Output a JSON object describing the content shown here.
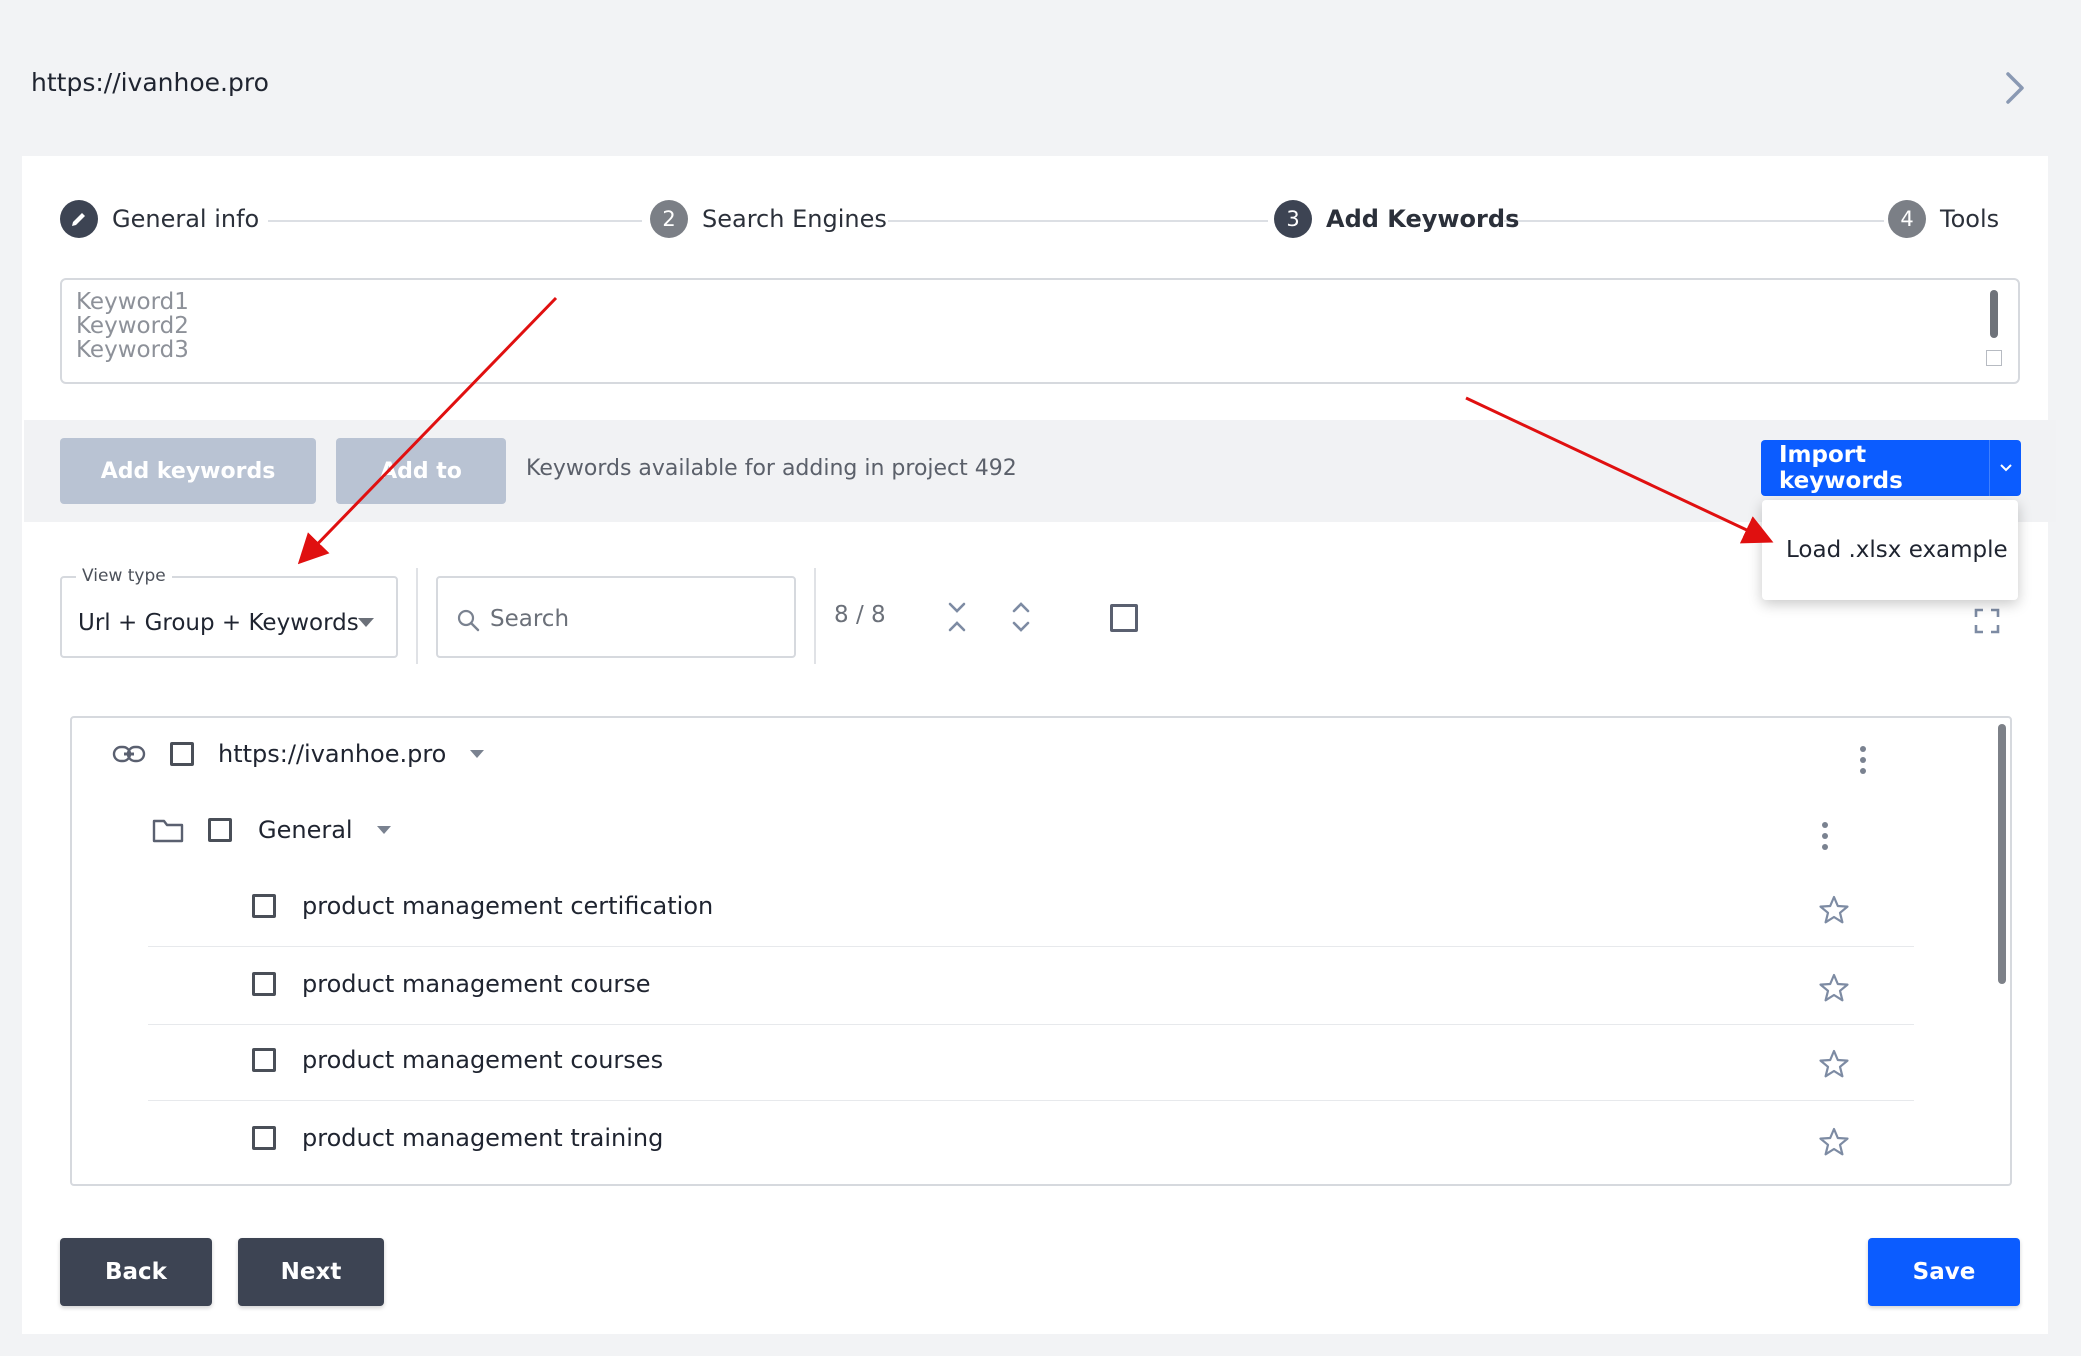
{
  "header": {
    "url": "https://ivanhoe.pro"
  },
  "stepper": [
    {
      "num": "",
      "label": "General info"
    },
    {
      "num": "2",
      "label": "Search Engines"
    },
    {
      "num": "3",
      "label": "Add Keywords"
    },
    {
      "num": "4",
      "label": "Tools"
    }
  ],
  "keywords_input": {
    "placeholder_lines": [
      "Keyword1",
      "Keyword2",
      "Keyword3"
    ]
  },
  "toolbar": {
    "add_keywords_label": "Add keywords",
    "add_to_label": "Add to",
    "available_text": "Keywords available for adding in project 492",
    "import_label": "Import keywords"
  },
  "import_menu": {
    "items": [
      "Load .xlsx example"
    ]
  },
  "filters": {
    "view_type_label": "View type",
    "view_type_value": "Url + Group + Keywords",
    "search_placeholder": "Search",
    "count": "8 / 8"
  },
  "tree": {
    "url": "https://ivanhoe.pro",
    "group": "General",
    "keywords": [
      "product management certification",
      "product management course",
      "product management courses",
      "product management training"
    ]
  },
  "footer": {
    "back_label": "Back",
    "next_label": "Next",
    "save_label": "Save"
  },
  "colors": {
    "primary": "#0b5cff",
    "dark": "#3d4453",
    "annotation_arrow": "#e01010"
  }
}
